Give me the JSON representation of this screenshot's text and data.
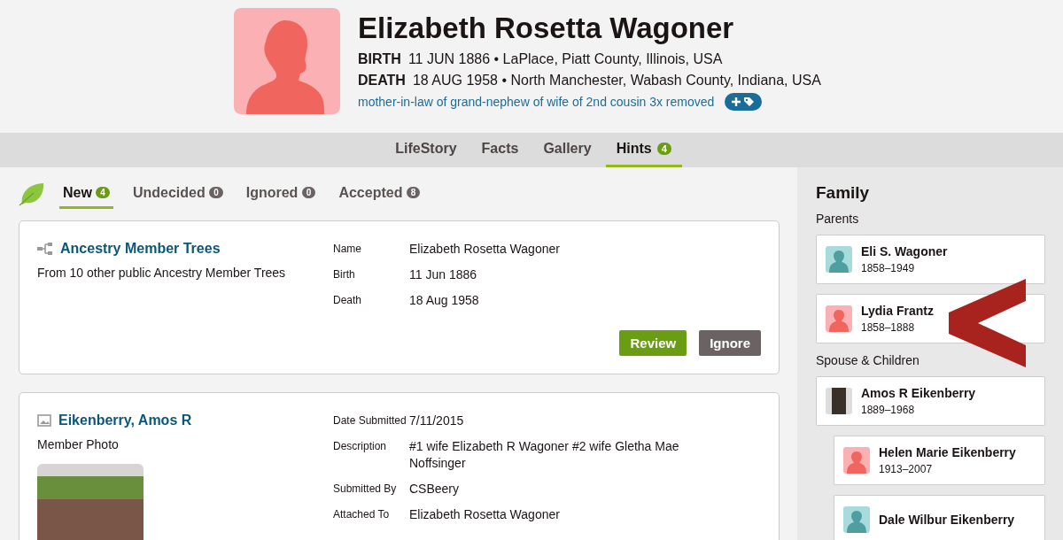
{
  "person": {
    "name": "Elizabeth Rosetta Wagoner",
    "kind": "female",
    "facts": [
      {
        "label": "BIRTH",
        "value": "11 JUN 1886 • LaPlace, Piatt County, Illinois, USA"
      },
      {
        "label": "DEATH",
        "value": "18 AUG 1958 • North Manchester, Wabash County, Indiana, USA"
      }
    ],
    "relationship": "mother-in-law of grand-nephew of wife of 2nd cousin 3x removed"
  },
  "nav_tabs": [
    {
      "label": "LifeStory",
      "selected": false
    },
    {
      "label": "Facts",
      "selected": false
    },
    {
      "label": "Gallery",
      "selected": false
    },
    {
      "label": "Hints",
      "selected": true,
      "count": "4"
    }
  ],
  "hint_tabs": [
    {
      "label": "New",
      "count": "4",
      "selected": true
    },
    {
      "label": "Undecided",
      "count": "0",
      "selected": false
    },
    {
      "label": "Ignored",
      "count": "0",
      "selected": false
    },
    {
      "label": "Accepted",
      "count": "8",
      "selected": false
    }
  ],
  "hints": [
    {
      "kind": "tree",
      "title": "Ancestry Member Trees",
      "subtitle": "From 10 other public Ancestry Member Trees",
      "fields": [
        {
          "label": "Name",
          "value": "Elizabeth Rosetta Wagoner"
        },
        {
          "label": "Birth",
          "value": "11 Jun 1886"
        },
        {
          "label": "Death",
          "value": "18 Aug 1958"
        }
      ],
      "buttons": [
        {
          "label": "Review",
          "kind": "primary"
        },
        {
          "label": "Ignore",
          "kind": "secondary"
        }
      ]
    },
    {
      "kind": "photo",
      "title": "Eikenberry, Amos R",
      "subtitle": "Member Photo",
      "fields": [
        {
          "label": "Date Submitted",
          "value": "7/11/2015"
        },
        {
          "label": "Description",
          "value": "#1 wife Elizabeth R Wagoner #2 wife Gletha Mae Noffsinger"
        },
        {
          "label": "Submitted By",
          "value": "CSBeery"
        },
        {
          "label": "Attached To",
          "value": "Elizabeth Rosetta Wagoner"
        }
      ]
    }
  ],
  "family": {
    "title": "Family",
    "groups": [
      {
        "label": "Parents",
        "members": [
          {
            "name": "Eli S. Wagoner",
            "dates": "1858–1949",
            "kind": "male"
          },
          {
            "name": "Lydia Frantz",
            "dates": "1858–1888",
            "kind": "female"
          }
        ]
      },
      {
        "label": "Spouse & Children",
        "members": [
          {
            "name": "Amos R Eikenberry",
            "dates": "1889–1968",
            "kind": "photo",
            "children": [
              {
                "name": "Helen Marie Eikenberry",
                "dates": "1913–2007",
                "kind": "female"
              },
              {
                "name": "Dale Wilbur Eikenberry",
                "kind": "male"
              }
            ]
          }
        ]
      }
    ]
  }
}
